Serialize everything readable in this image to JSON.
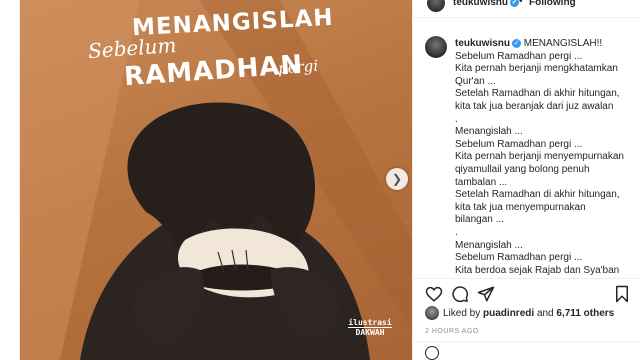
{
  "post": {
    "title_line1": "MENANGISLAH",
    "title_script": "Sebelum",
    "title_line2": "RAMADHAN",
    "title_pergi": "pergi",
    "watermark_top": "ilustrasi",
    "watermark_bottom": "DAKWAH"
  },
  "header": {
    "username": "teukuwisnu",
    "separator": "•",
    "follow_label": "Following"
  },
  "caption": {
    "username": "teukuwisnu",
    "first_line": "MENANGISLAH!!",
    "lines": [
      "Sebelum Ramadhan pergi ...",
      "Kita pernah berjanji mengkhatamkan",
      "Qur'an ...",
      "Setelah Ramadhan di akhir hitungan,",
      "kita tak jua beranjak dari juz awalan",
      ".",
      "Menangislah ...",
      "Sebelum Ramadhan pergi ...",
      "Kita pernah berjanji menyempurnakan",
      "qiyamullail yang bolong penuh",
      "tambalan ...",
      "Setelah Ramadhan di akhir hitungan,",
      "kita tak jua menyempurnakan",
      "bilangan ...",
      ".",
      "Menangislah ...",
      "Sebelum Ramadhan pergi ...",
      "Kita berdoa sejak Rajab dan Sya'ban"
    ]
  },
  "likes": {
    "prefix": "Liked by",
    "user": "puadinredi",
    "connector": "and",
    "count": "6,711 others"
  },
  "timestamp": "2 HOURS AGO",
  "icons": {
    "like": "heart-icon",
    "comment": "comment-icon",
    "share": "share-icon",
    "save": "bookmark-icon",
    "next": "chevron-right-icon"
  },
  "colors": {
    "verified": "#3897f0",
    "image_bg": "#b77440"
  }
}
